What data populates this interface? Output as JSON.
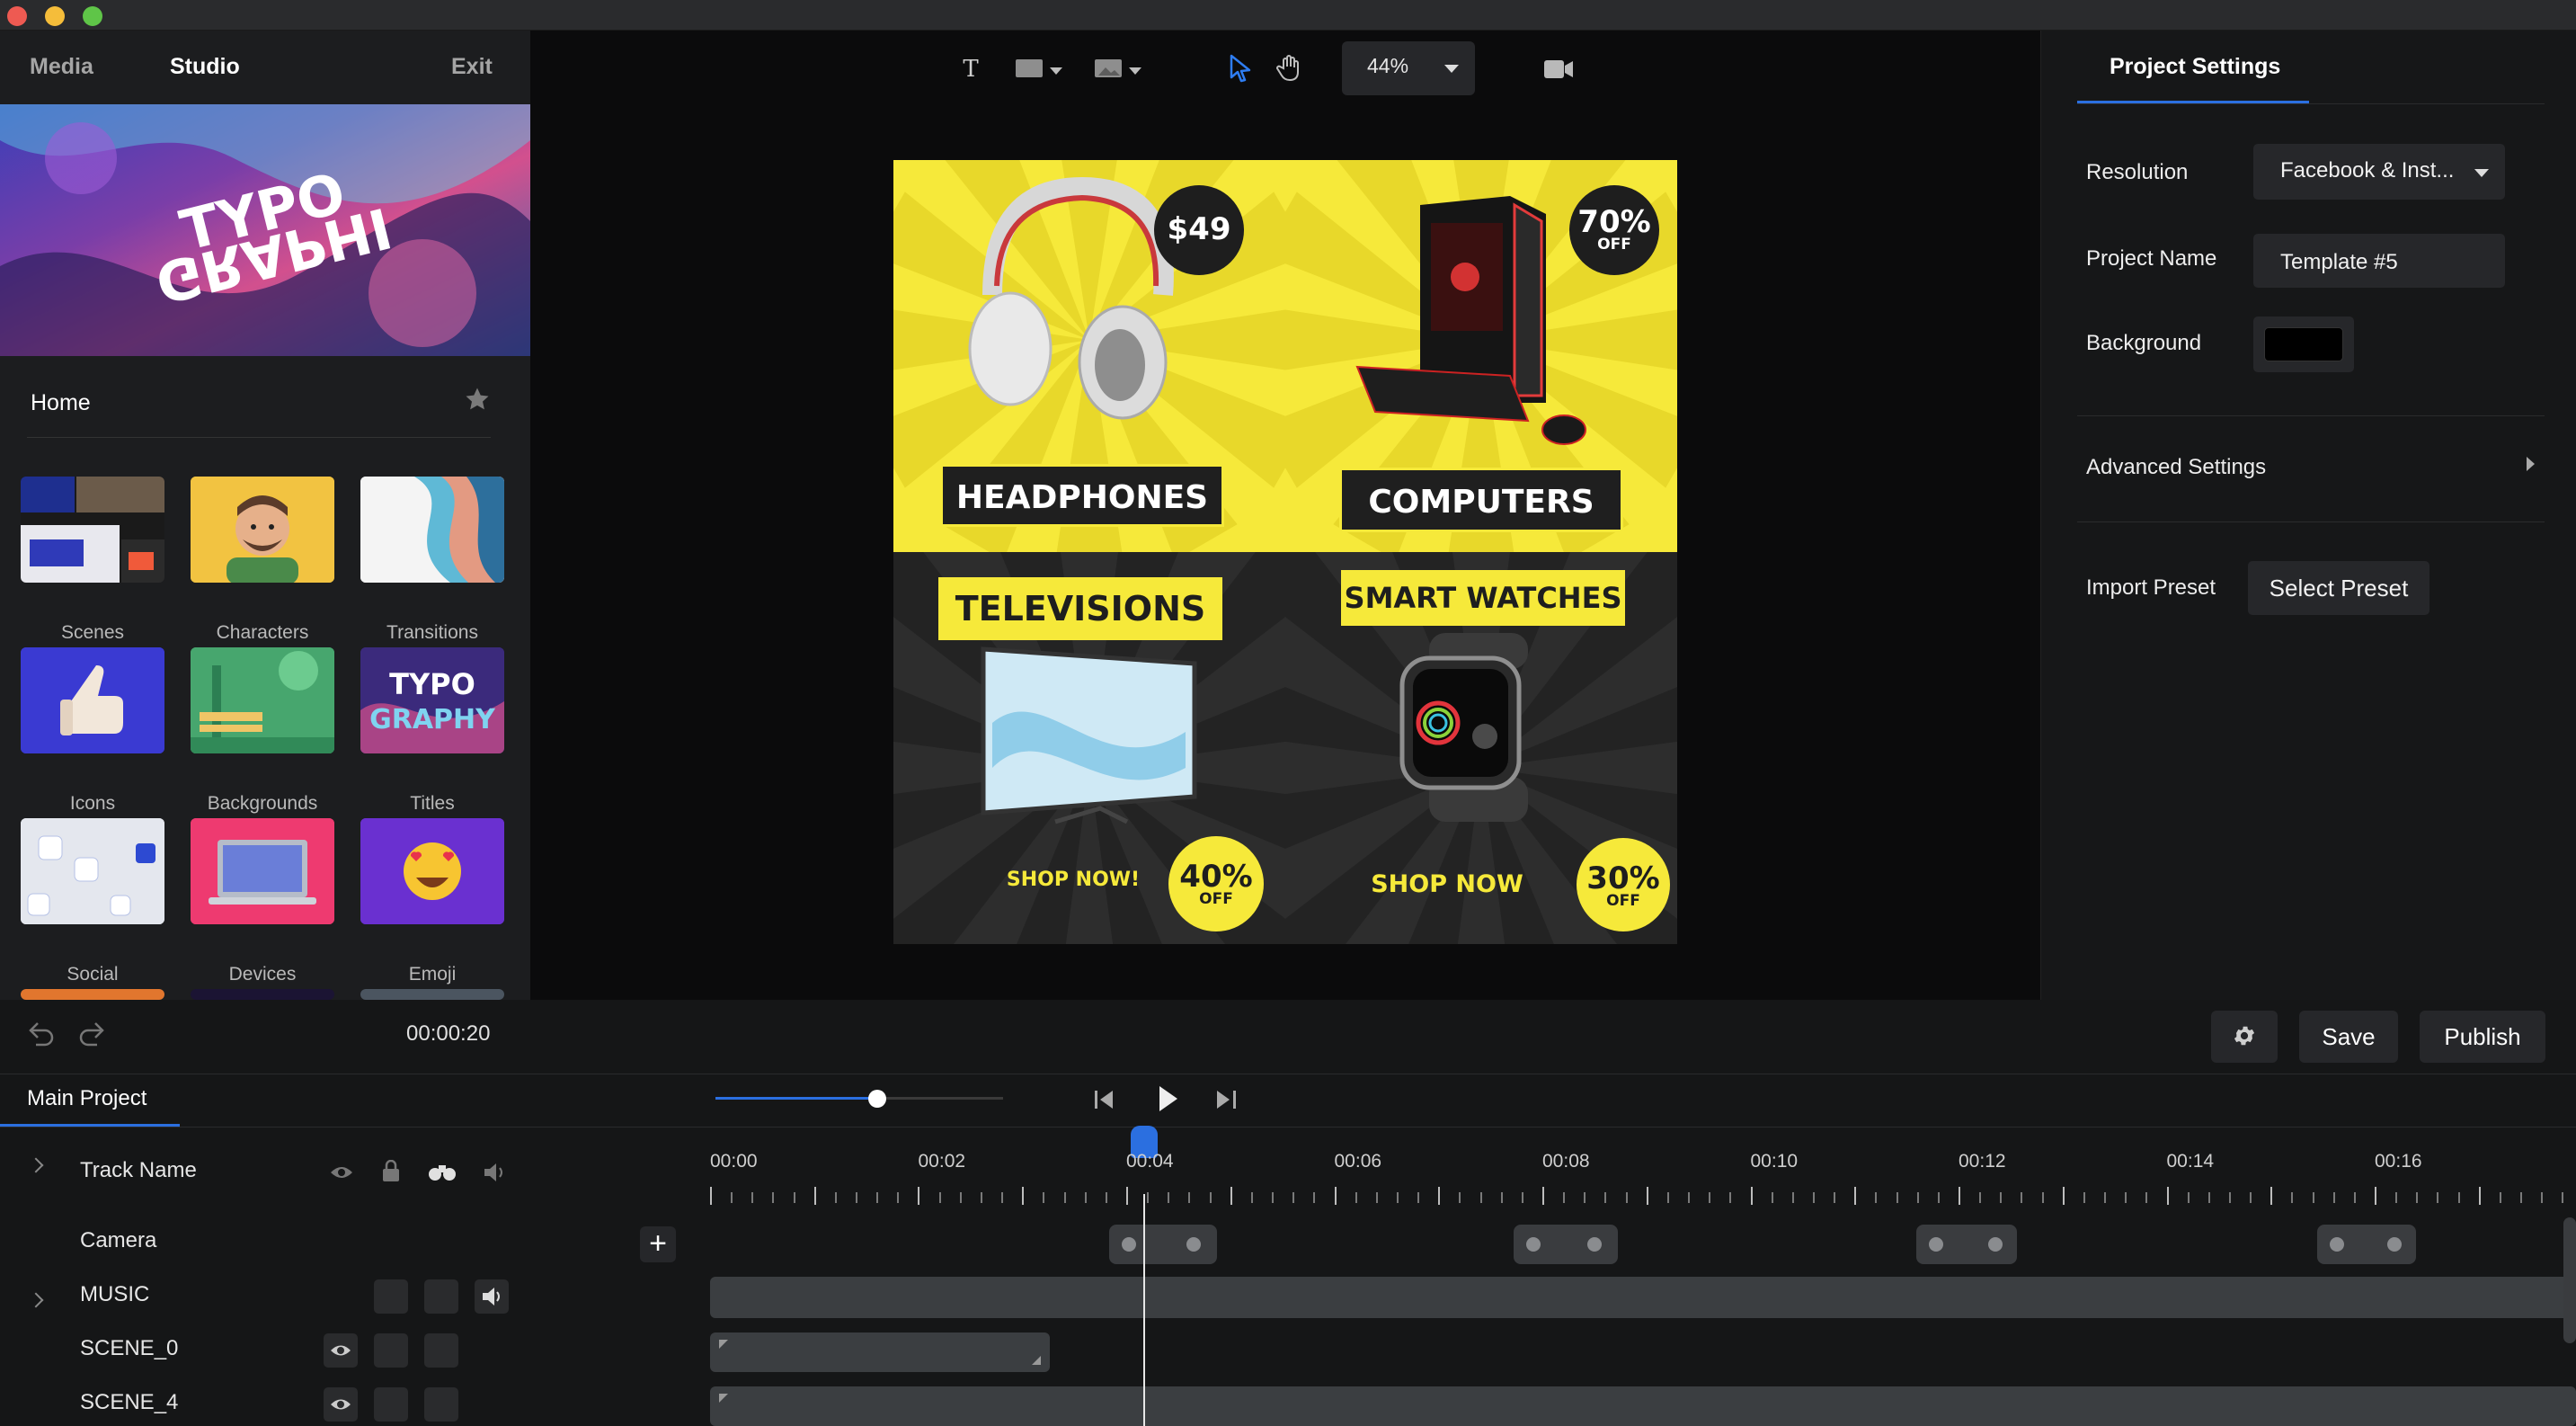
{
  "window": {
    "traffic_lights": [
      "#ee5a52",
      "#f5bd3a",
      "#5fc548"
    ]
  },
  "left_panel": {
    "tabs": [
      {
        "label": "Media"
      },
      {
        "label": "Studio"
      }
    ],
    "exit_label": "Exit",
    "home_label": "Home",
    "categories": [
      {
        "label": "Scenes"
      },
      {
        "label": "Characters"
      },
      {
        "label": "Transitions"
      },
      {
        "label": "Icons"
      },
      {
        "label": "Backgrounds"
      },
      {
        "label": "Titles"
      },
      {
        "label": "Social"
      },
      {
        "label": "Devices"
      },
      {
        "label": "Emoji"
      }
    ],
    "hero_text": [
      "TYPO",
      "GRAPHI"
    ],
    "titles_thumb_text": [
      "TYPO",
      "GRAPHY"
    ]
  },
  "toolbar": {
    "zoom": "44%"
  },
  "poster": {
    "quadrants": [
      {
        "label": "HEADPHONES",
        "badge": "$49"
      },
      {
        "label": "COMPUTERS",
        "badge": "70%",
        "badge_sub": "OFF"
      },
      {
        "label": "TELEVISIONS",
        "badge": "40%",
        "badge_sub": "OFF",
        "cta": "SHOP NOW!"
      },
      {
        "label": "SMART WATCHES",
        "badge": "30%",
        "badge_sub": "OFF",
        "cta": "SHOP NOW"
      }
    ],
    "colors": {
      "yellow": "#f7ea3a",
      "dark": "#242424"
    }
  },
  "project_settings": {
    "title": "Project Settings",
    "resolution_label": "Resolution",
    "resolution_value": "Facebook & Inst...",
    "project_name_label": "Project Name",
    "project_name_value": "Template #5",
    "background_label": "Background",
    "background_color": "#000000",
    "advanced_label": "Advanced Settings",
    "import_preset_label": "Import Preset",
    "select_preset_label": "Select Preset"
  },
  "timeline": {
    "current_time": "00:00:20",
    "save_label": "Save",
    "publish_label": "Publish",
    "main_tab": "Main Project",
    "track_header": "Track Name",
    "tracks": [
      {
        "label": "Camera"
      },
      {
        "label": "MUSIC"
      },
      {
        "label": "SCENE_0"
      },
      {
        "label": "SCENE_4"
      }
    ],
    "time_labels": [
      "00:00",
      "00:02",
      "00:04",
      "00:06",
      "00:08",
      "00:10",
      "00:12",
      "00:14",
      "00:16"
    ],
    "accent": "#2b6fe0"
  }
}
